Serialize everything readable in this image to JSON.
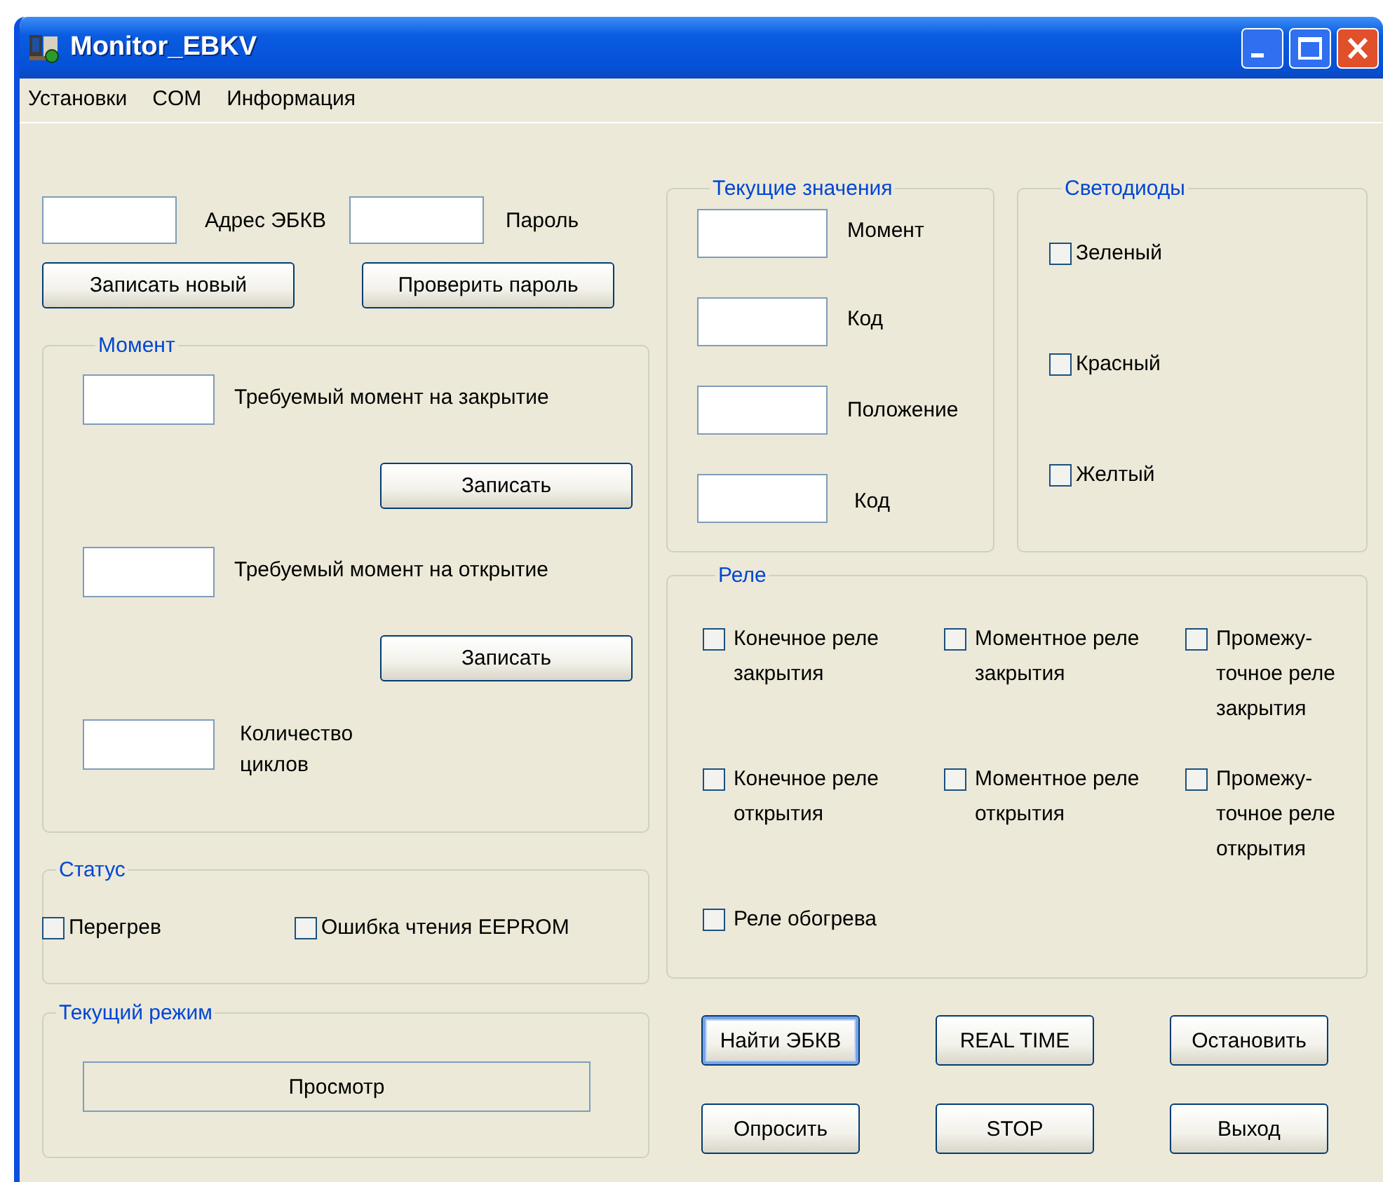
{
  "window": {
    "title": "Monitor_EBKV"
  },
  "menu": [
    {
      "label": "Установки"
    },
    {
      "label": "COM"
    },
    {
      "label": "Информация"
    }
  ],
  "device": {
    "fields": [
      {
        "label": "Адрес ЭБКВ"
      },
      {
        "label": "Пароль"
      }
    ],
    "buttons": [
      {
        "label": "Записать новый"
      },
      {
        "label": "Проверить пароль"
      }
    ]
  },
  "moment": {
    "title": "Момент",
    "items": [
      {
        "kind": "field",
        "label": "Требуемый момент на закрытие"
      },
      {
        "kind": "button",
        "label": "Записать"
      },
      {
        "kind": "field",
        "label": "Требуемый момент на открытие"
      },
      {
        "kind": "button",
        "label": "Записать"
      },
      {
        "kind": "field",
        "label": "Количество циклов"
      }
    ]
  },
  "status": {
    "title": "Статус",
    "checkboxes": [
      {
        "label": "Перегрев",
        "checked": false
      },
      {
        "label": "Ошибка чтения EEPROM",
        "checked": false
      }
    ]
  },
  "mode": {
    "title": "Текущий режим",
    "value": "Просмотр"
  },
  "current_values": {
    "title": "Текущие значения",
    "fields": [
      {
        "label": "Момент"
      },
      {
        "label": "Код"
      },
      {
        "label": "Положение"
      },
      {
        "label": "Код"
      }
    ]
  },
  "leds": {
    "title": "Светодиоды",
    "checkboxes": [
      {
        "label": "Зеленый",
        "checked": false
      },
      {
        "label": "Красный",
        "checked": false
      },
      {
        "label": "Желтый",
        "checked": false
      }
    ]
  },
  "relays": {
    "title": "Реле",
    "checkboxes": [
      {
        "label": "Конечное реле закрытия",
        "checked": false
      },
      {
        "label": "Моментное реле закрытия",
        "checked": false
      },
      {
        "label": "Промежу-точное реле закрытия",
        "checked": false
      },
      {
        "label": "Конечное реле открытия",
        "checked": false
      },
      {
        "label": "Моментное реле открытия",
        "checked": false
      },
      {
        "label": "Промежу-точное реле открытия",
        "checked": false
      },
      {
        "label": "Реле обогрева",
        "checked": false
      }
    ]
  },
  "actions": [
    {
      "label": "Найти ЭБКВ",
      "focused": true
    },
    {
      "label": "REAL TIME",
      "focused": false
    },
    {
      "label": "Остановить",
      "focused": false
    },
    {
      "label": "Опросить",
      "focused": false
    },
    {
      "label": "STOP",
      "focused": false
    },
    {
      "label": "Выход",
      "focused": false
    }
  ]
}
